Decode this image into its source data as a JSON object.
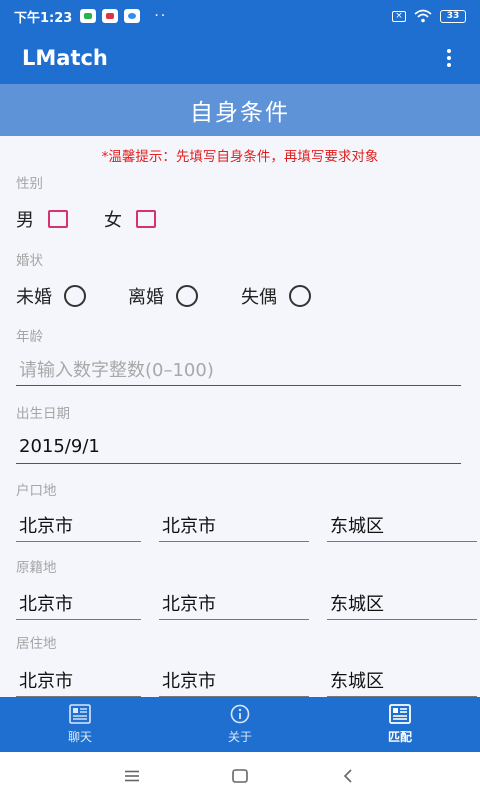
{
  "status_bar": {
    "time": "下午1:23",
    "battery": "33"
  },
  "app_bar": {
    "title": "LMatch"
  },
  "section_title": "自身条件",
  "tip": "*温馨提示：先填写自身条件，再填写要求对象",
  "gender": {
    "label": "性别",
    "options": [
      "男",
      "女"
    ]
  },
  "marital": {
    "label": "婚状",
    "options": [
      "未婚",
      "离婚",
      "失偶"
    ]
  },
  "age": {
    "label": "年龄",
    "placeholder": "请输入数字整数(0–100)",
    "value": ""
  },
  "birth": {
    "label": "出生日期",
    "value": "2015/9/1"
  },
  "hukou": {
    "label": "户口地",
    "province": "北京市",
    "city": "北京市",
    "district": "东城区"
  },
  "origin": {
    "label": "原籍地",
    "province": "北京市",
    "city": "北京市",
    "district": "东城区"
  },
  "residence": {
    "label": "居住地",
    "province": "北京市",
    "city": "北京市",
    "district": "东城区"
  },
  "bottom_nav": {
    "items": [
      {
        "label": "聊天"
      },
      {
        "label": "关于"
      },
      {
        "label": "匹配"
      }
    ]
  },
  "colors": {
    "primary": "#1e6fd0",
    "header": "#5f93d8",
    "accent_red": "#e02020",
    "checkbox": "#d6336c"
  }
}
